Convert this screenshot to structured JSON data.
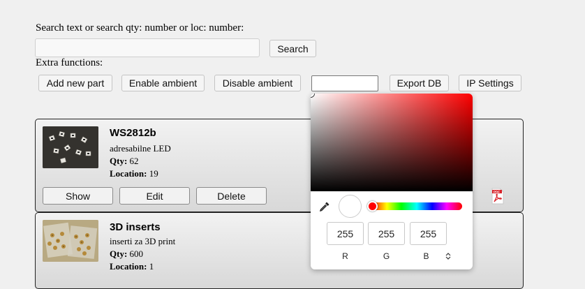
{
  "search": {
    "label": "Search text or search qty: number or loc: number:",
    "value": "",
    "button": "Search"
  },
  "extra": {
    "label": "Extra functions:",
    "buttons": [
      "Add new part",
      "Enable ambient",
      "Disable ambient",
      "Export DB",
      "IP Settings"
    ],
    "color_value": ""
  },
  "parts": [
    {
      "name": "WS2812b",
      "description": "adresabilne LED",
      "qty_label": "Qty:",
      "qty": "62",
      "location_label": "Location:",
      "location": "19",
      "actions": [
        "Show",
        "Edit",
        "Delete"
      ]
    },
    {
      "name": "3D inserts",
      "description": "inserti za 3D print",
      "qty_label": "Qty:",
      "qty": "600",
      "location_label": "Location:",
      "location": "1"
    }
  ],
  "color_picker": {
    "hue_color": "#ff0000",
    "selected_color": "#ffffff",
    "r": "255",
    "g": "255",
    "b": "255",
    "r_label": "R",
    "g_label": "G",
    "b_label": "B",
    "mode_toggle_icon": "⌃⌄",
    "eyedropper_icon": "eyedropper-icon"
  },
  "pdf_icon": "pdf-icon"
}
